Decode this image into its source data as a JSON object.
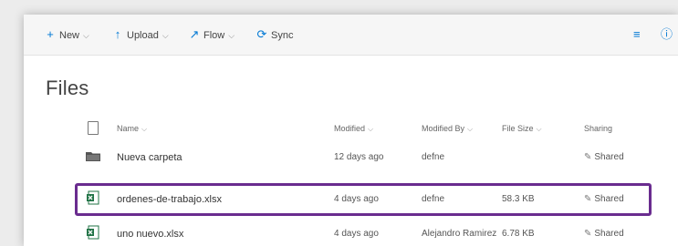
{
  "toolbar": {
    "new_label": "New",
    "upload_label": "Upload",
    "flow_label": "Flow",
    "sync_label": "Sync",
    "new_icon": "plus-icon",
    "upload_icon": "upload-arrow-icon",
    "flow_icon": "flow-icon",
    "sync_icon": "sync-icon",
    "sort_icon": "view-options-icon",
    "info_icon": "info-icon"
  },
  "page": {
    "title": "Files"
  },
  "columns": {
    "name": "Name",
    "modified": "Modified",
    "modified_by": "Modified By",
    "file_size": "File Size",
    "sharing": "Sharing"
  },
  "rows": [
    {
      "icon": "folder-icon",
      "name": "Nueva carpeta",
      "modified": "12 days ago",
      "modified_by": "defne",
      "file_size": "",
      "sharing": "Shared"
    },
    {
      "icon": "excel-file-icon",
      "name": "ordenes-de-trabajo.xlsx",
      "modified": "4 days ago",
      "modified_by": "defne",
      "file_size": "58.3 KB",
      "sharing": "Shared"
    },
    {
      "icon": "excel-file-icon",
      "name": "uno nuevo.xlsx",
      "modified": "4 days ago",
      "modified_by": "Alejandro Ramirez",
      "file_size": "6.78 KB",
      "sharing": "Shared"
    }
  ],
  "colors": {
    "highlight": "#6a2c8f",
    "accent": "#0078d4",
    "excel_green": "#217346"
  }
}
